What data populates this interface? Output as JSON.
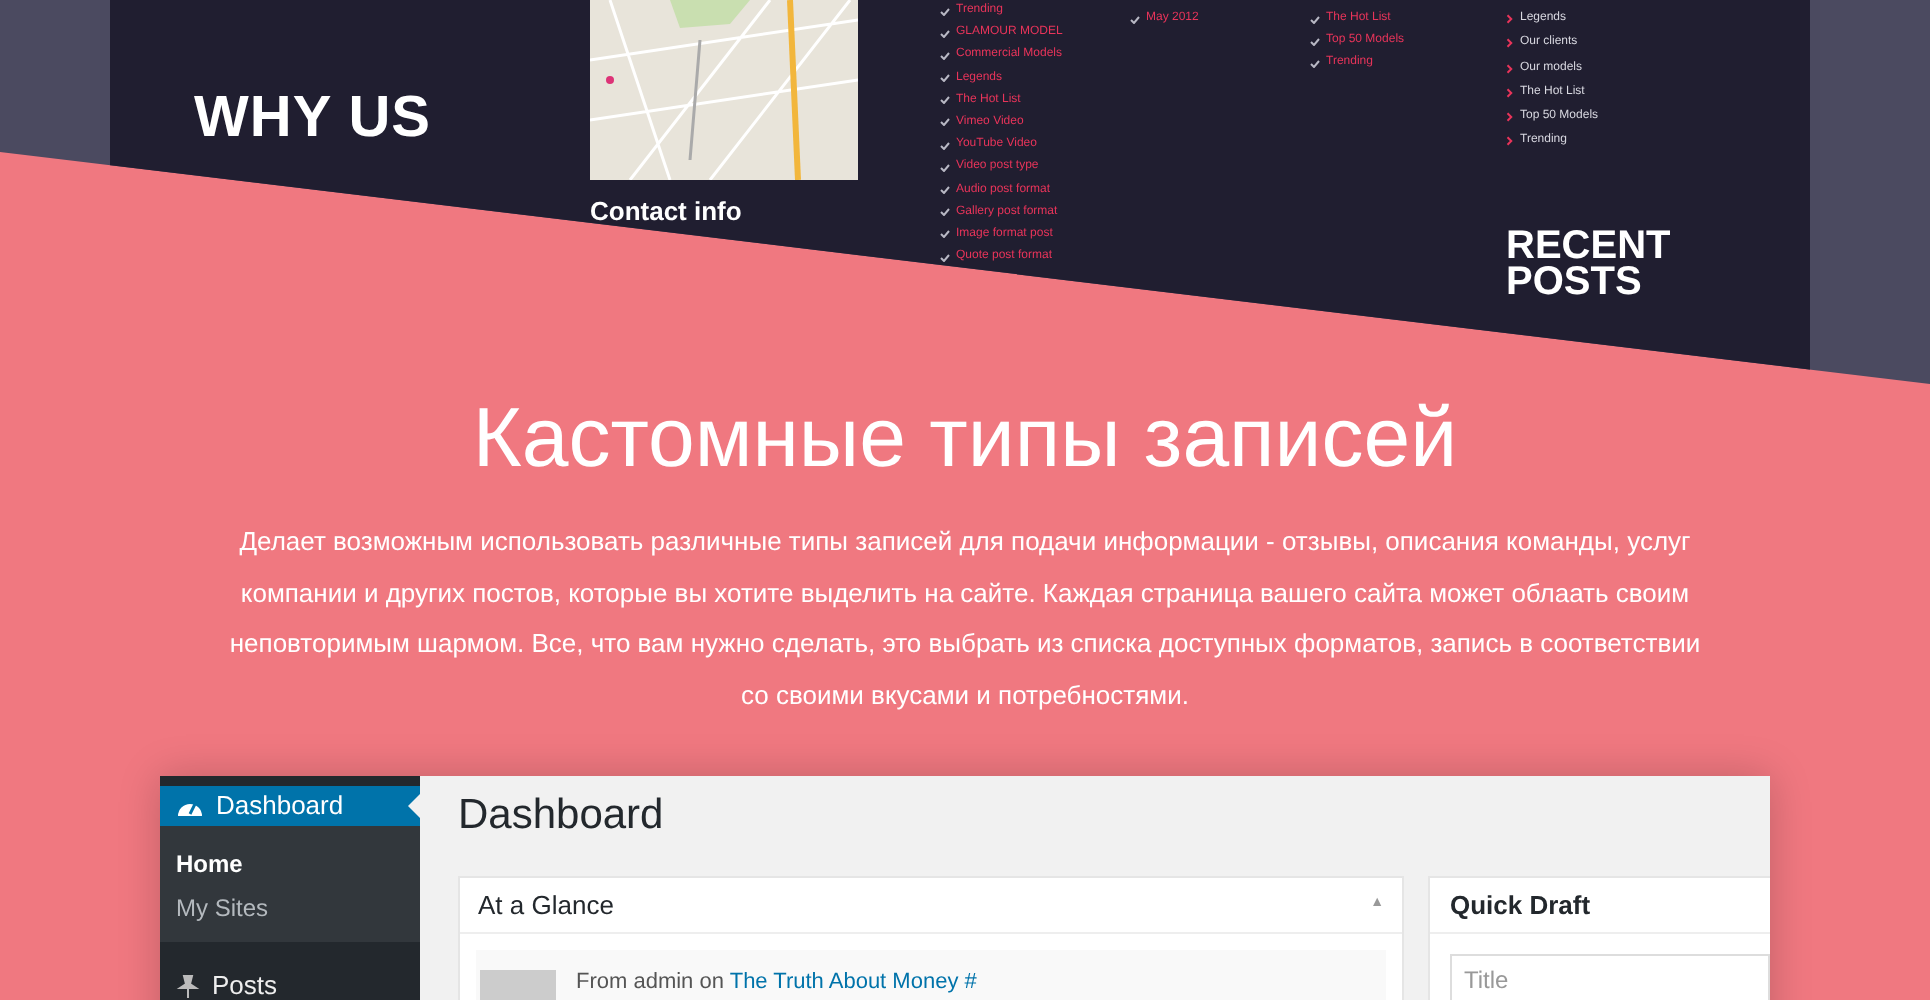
{
  "footer_preview": {
    "why_us_heading": "WHY US",
    "contact_heading": "Contact info",
    "recent_posts_heading": "RECENT POSTS",
    "link_columns": [
      {
        "kind": "check",
        "items": [
          "Trending",
          "GLAMOUR MODEL",
          "Commercial Models",
          "Legends",
          "The Hot List",
          "Vimeo Video",
          "YouTube Video",
          "Video post type",
          "Audio post format",
          "Gallery post format",
          "Image format post",
          "Quote post format"
        ]
      },
      {
        "kind": "check",
        "items": [
          "May 2012"
        ]
      },
      {
        "kind": "check",
        "items": [
          "The Hot List",
          "Top 50 Models",
          "Trending"
        ]
      },
      {
        "kind": "chevron",
        "items": [
          "Legends",
          "Our clients",
          "Our models",
          "The Hot List",
          "Top 50 Models",
          "Trending"
        ]
      }
    ]
  },
  "hero": {
    "title": "Кастомные типы записей",
    "description": "Делает возможным использовать различные типы записей для подачи информации - отзывы, описания команды, услуг компании и других постов, которые вы хотите выделить на сайте. Каждая страница вашего сайта может облаать своим неповторимым шармом. Все, что вам нужно сделать, это выбрать из списка доступных форматов, запись в соответствии со своими вкусами и потребностями."
  },
  "dashboard_preview": {
    "sidebar": [
      {
        "kind": "menu",
        "label": "Dashboard",
        "selected": true
      },
      {
        "kind": "submenu",
        "label": "Home",
        "selected": true
      },
      {
        "kind": "submenu",
        "label": "My Sites",
        "selected": false
      },
      {
        "kind": "menu",
        "label": "Posts",
        "selected": false
      }
    ],
    "page_title": "Dashboard",
    "glance": {
      "title": "At a Glance",
      "toggle": "▲",
      "activity_prefix": "From admin on",
      "activity_link": "The Truth About Money #"
    },
    "quick_draft": {
      "title": "Quick Draft",
      "placeholder": "Title"
    }
  }
}
